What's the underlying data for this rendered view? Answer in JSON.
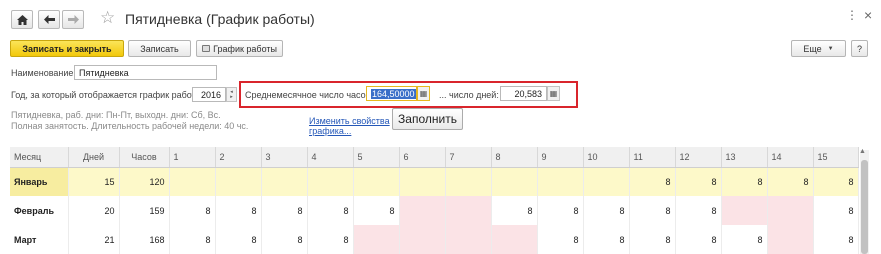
{
  "window": {
    "title": "Пятидневка (График работы)",
    "nav": {
      "home_icon": "home-icon",
      "back_icon": "arrow-left-icon",
      "forward_icon": "arrow-right-icon"
    },
    "controls": {
      "menu": "⋮",
      "close": "×"
    }
  },
  "toolbar": {
    "save_close": "Записать и закрыть",
    "save": "Записать",
    "schedule": "График работы",
    "more": "Еще",
    "help": "?"
  },
  "form": {
    "name_label": "Наименование:",
    "name_value": "Пятидневка",
    "year_label": "Год, за который отображается график работы:",
    "year_value": "2016",
    "avg_hours_label": "Среднемесячное число часов:",
    "avg_hours_value": "164,50000",
    "days_label": "... число дней:",
    "days_value": "20,583",
    "description_line1": "Пятидневка, раб. дни: Пн-Пт, выходн. дни: Сб, Вс.",
    "description_line2": "Полная занятость. Длительность рабочей недели: 40 чс.",
    "change_link_line1": "Изменить свойства",
    "change_link_line2": "графика...",
    "fill_button": "Заполнить"
  },
  "table": {
    "headers": [
      "Месяц",
      "Дней",
      "Часов",
      "1",
      "2",
      "3",
      "4",
      "5",
      "6",
      "7",
      "8",
      "9",
      "10",
      "11",
      "12",
      "13",
      "14",
      "15"
    ],
    "rows": [
      {
        "month": "Январь",
        "days": "15",
        "hours": "120",
        "cells": [
          "",
          "",
          "",
          "",
          "",
          "",
          "",
          "",
          "",
          "",
          "8",
          "8",
          "8",
          "8",
          "8"
        ]
      },
      {
        "month": "Февраль",
        "days": "20",
        "hours": "159",
        "cells": [
          "8",
          "8",
          "8",
          "8",
          "8",
          "",
          "",
          "8",
          "8",
          "8",
          "8",
          "8",
          "",
          "",
          "8"
        ]
      },
      {
        "month": "Март",
        "days": "21",
        "hours": "168",
        "cells": [
          "8",
          "8",
          "8",
          "8",
          "",
          "",
          "",
          "",
          "8",
          "8",
          "8",
          "8",
          "8",
          "",
          "8"
        ]
      }
    ]
  },
  "colors": {
    "primary_button": "#f2c80b",
    "highlight_frame": "#d9252c",
    "selected_row": "#fdf9c9",
    "weekend_cell": "#fbe3e6",
    "link": "#2457b8"
  }
}
